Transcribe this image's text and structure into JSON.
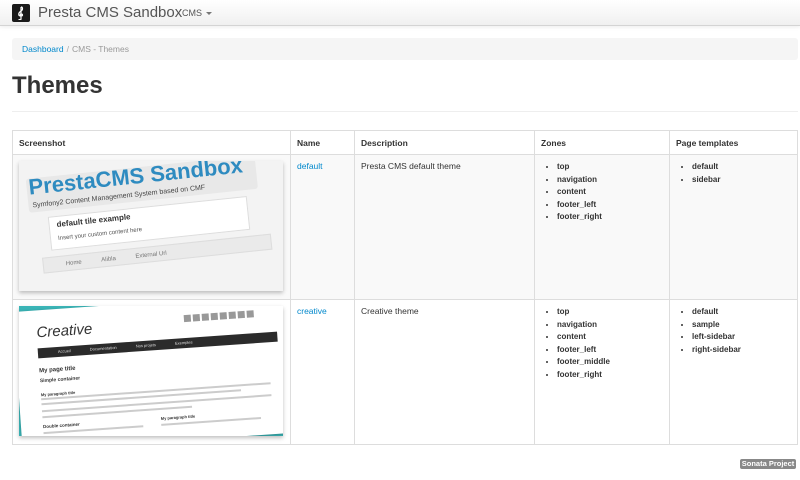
{
  "navbar": {
    "brand": "Presta CMS Sandbox",
    "menu_label": "CMS"
  },
  "breadcrumb": {
    "home": "Dashboard",
    "separator": "/",
    "current": "CMS - Themes"
  },
  "page": {
    "title": "Themes"
  },
  "table": {
    "headers": {
      "screenshot": "Screenshot",
      "name": "Name",
      "description": "Description",
      "zones": "Zones",
      "page_templates": "Page templates"
    },
    "rows": [
      {
        "name": "default",
        "description": "Presta CMS default theme",
        "zones": [
          "top",
          "navigation",
          "content",
          "footer_left",
          "footer_right"
        ],
        "page_templates": [
          "default",
          "sidebar"
        ]
      },
      {
        "name": "creative",
        "description": "Creative theme",
        "zones": [
          "top",
          "navigation",
          "content",
          "footer_left",
          "footer_middle",
          "footer_right"
        ],
        "page_templates": [
          "default",
          "sample",
          "left-sidebar",
          "right-sidebar"
        ]
      }
    ]
  },
  "screenshot_default": {
    "title": "PrestaCMS Sandbox",
    "subtitle": "Symfony2 Content Management System based on CMF",
    "block_title": "default tile example",
    "block_text": "Insert your custom content here",
    "nav": [
      "Home",
      "Alibla",
      "External Url"
    ]
  },
  "screenshot_creative": {
    "title": "Creative",
    "nav": [
      "Accueil",
      "Documentation",
      "Nos projets",
      "Exemples"
    ],
    "heading": "My page title",
    "subheading": "Simple container",
    "paragraph_title": "My paragraph title",
    "section": "Double container",
    "paragraph_title_2": "My paragraph title"
  },
  "footer": {
    "badge": "Sonata Project"
  },
  "colors": {
    "link": "#0088cc",
    "accent_default": "#2e8bc0",
    "accent_creative": "#3ab5b7"
  }
}
